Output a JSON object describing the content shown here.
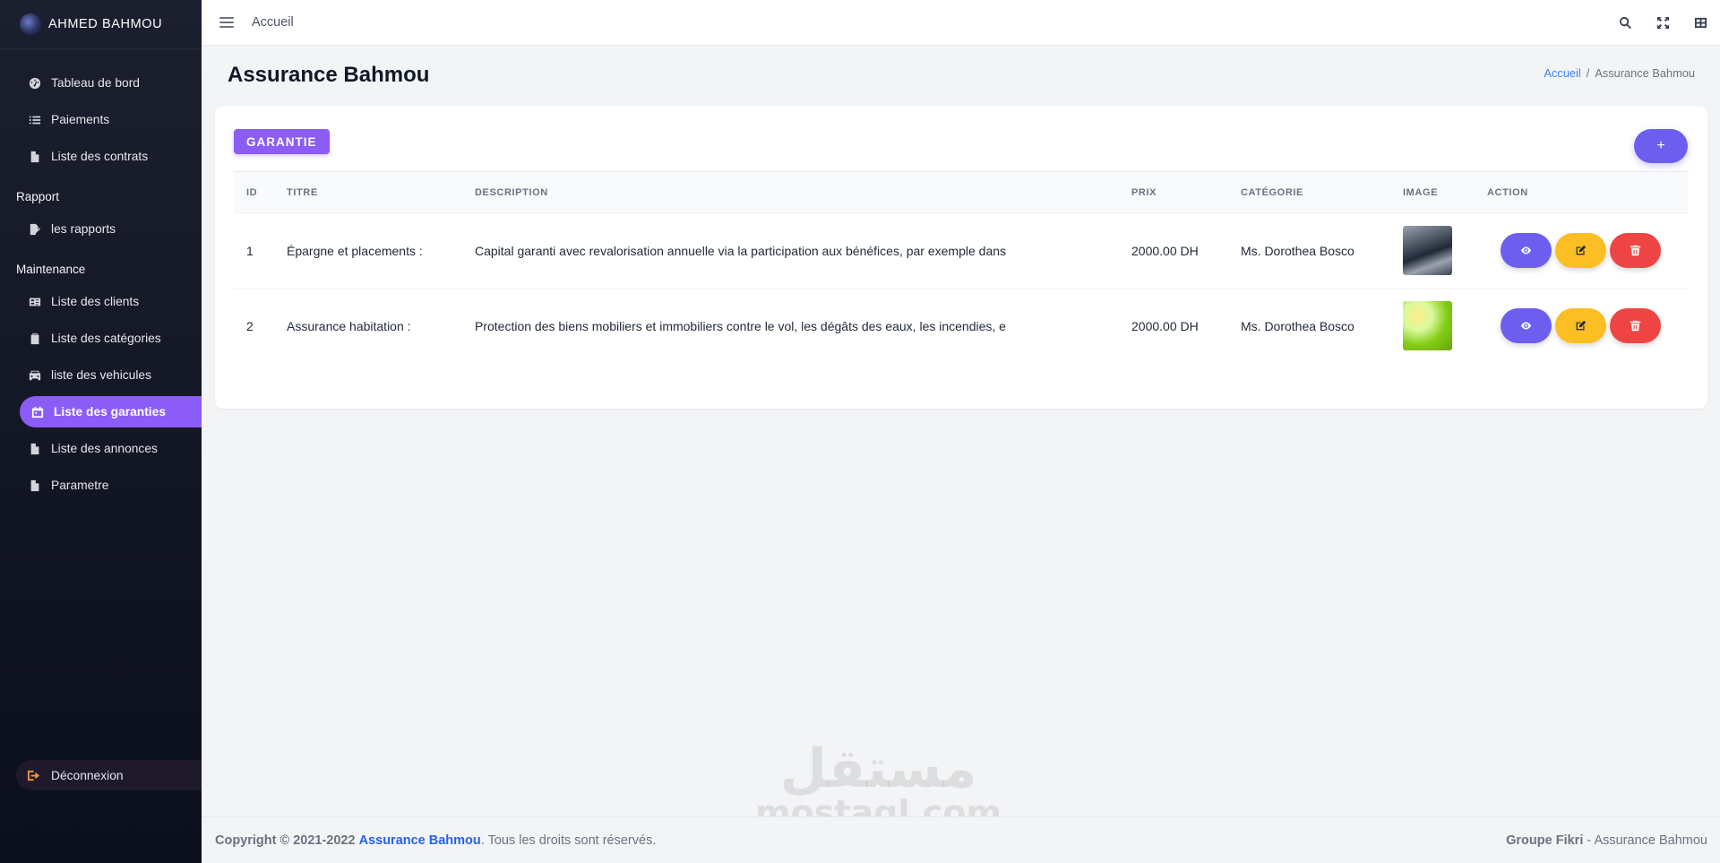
{
  "sidebar": {
    "brand": "AHMED BAHMOU",
    "items_top": [
      {
        "label": "Tableau de bord",
        "icon": "dashboard-icon"
      },
      {
        "label": "Paiements",
        "icon": "list-icon"
      },
      {
        "label": "Liste des contrats",
        "icon": "file-icon"
      }
    ],
    "section_rapport": "Rapport",
    "items_rapport": [
      {
        "label": "les rapports",
        "icon": "report-icon"
      }
    ],
    "section_maintenance": "Maintenance",
    "items_maintenance": [
      {
        "label": "Liste des clients",
        "icon": "id-card-icon"
      },
      {
        "label": "Liste des catégories",
        "icon": "clipboard-icon"
      },
      {
        "label": "liste des vehicules",
        "icon": "car-icon"
      },
      {
        "label": "Liste des garanties",
        "icon": "calendar-icon",
        "active": true
      },
      {
        "label": "Liste des annonces",
        "icon": "file-icon"
      },
      {
        "label": "Parametre",
        "icon": "file-icon"
      }
    ],
    "logout": "Déconnexion"
  },
  "topbar": {
    "home_link": "Accueil",
    "icons": [
      "search-icon",
      "expand-icon",
      "grid-icon"
    ]
  },
  "page": {
    "title": "Assurance Bahmou",
    "breadcrumb": [
      "Accueil",
      "Assurance Bahmou"
    ]
  },
  "card": {
    "badge": "GARANTIE",
    "add_label": "+",
    "columns": [
      "ID",
      "TITRE",
      "DESCRIPTION",
      "PRIX",
      "CATÉGORIE",
      "IMAGE",
      "ACTION"
    ],
    "rows": [
      {
        "id": "1",
        "titre": "Épargne et placements :",
        "description": "Capital garanti avec revalorisation annuelle via la participation aux bénéfices, par exemple dans",
        "prix": "2000.00 DH",
        "categorie": "Ms. Dorothea Bosco"
      },
      {
        "id": "2",
        "titre": "Assurance habitation :",
        "description": "Protection des biens mobiliers et immobiliers contre le vol, les dégâts des eaux, les incendies, e",
        "prix": "2000.00 DH",
        "categorie": "Ms. Dorothea Bosco"
      }
    ]
  },
  "watermark": {
    "big": "مستقل",
    "small": "mostaql.com"
  },
  "footer": {
    "copyright": "Copyright © 2021-2022",
    "company": "Assurance Bahmou",
    "rights": ". Tous les droits sont réservés.",
    "group": "Groupe Fikri",
    "right_suffix": " - Assurance Bahmou"
  },
  "colors": {
    "accent": "#8b5cf6",
    "view": "#6d5ef0",
    "edit": "#fbbf24",
    "delete": "#ef4444"
  }
}
